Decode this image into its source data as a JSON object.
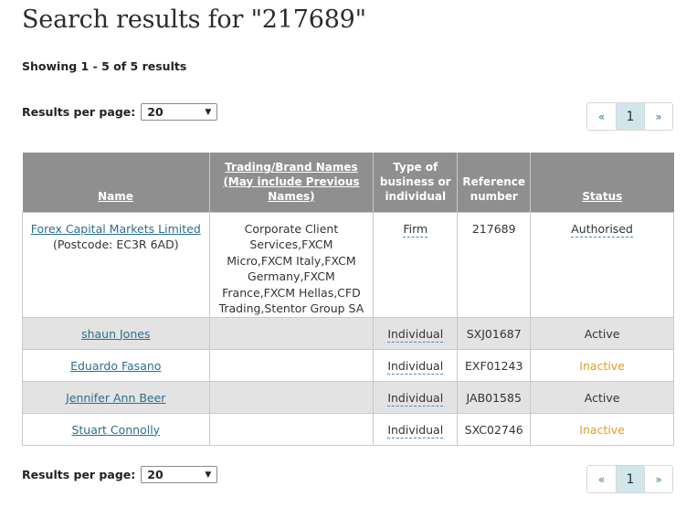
{
  "page": {
    "title": "Search results for \"217689\"",
    "showing": "Showing 1 - 5 of 5 results"
  },
  "results_per_page": {
    "label": "Results per page:",
    "value": "20"
  },
  "pagination": {
    "prev": "«",
    "current": "1",
    "next": "»"
  },
  "table": {
    "headers": {
      "name": "Name",
      "trading": "Trading/Brand Names (May include Previous Names)",
      "type": "Type of business or individual",
      "reference": "Reference number",
      "status": "Status"
    },
    "rows": [
      {
        "name": "Forex Capital Markets Limited",
        "postcode": "(Postcode: EC3R 6AD)",
        "trading": "Corporate Client Services,FXCM Micro,FXCM Italy,FXCM Germany,FXCM France,FXCM Hellas,CFD Trading,Stentor Group SA",
        "type": "Firm",
        "reference": "217689",
        "status": "Authorised"
      },
      {
        "name": "shaun Jones",
        "trading": "",
        "type": "Individual",
        "reference": "SXJ01687",
        "status": "Active"
      },
      {
        "name": "Eduardo Fasano",
        "trading": "",
        "type": "Individual",
        "reference": "EXF01243",
        "status": "Inactive"
      },
      {
        "name": "Jennifer Ann Beer",
        "trading": "",
        "type": "Individual",
        "reference": "JAB01585",
        "status": "Active"
      },
      {
        "name": "Stuart Connolly",
        "trading": "",
        "type": "Individual",
        "reference": "SXC02746",
        "status": "Inactive"
      }
    ]
  },
  "colors": {
    "header_bg": "#8f8f8f",
    "link": "#2a6f8c",
    "inactive": "#e69a1f",
    "pager_active_bg": "#cfe7eb"
  }
}
